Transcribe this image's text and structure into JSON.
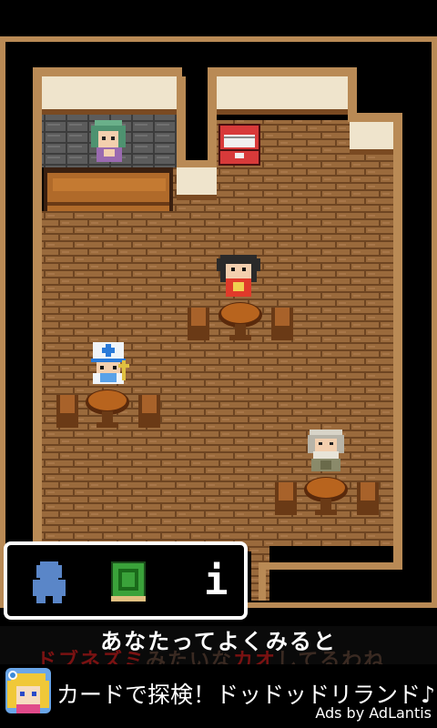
{
  "menu": {
    "items": [
      {
        "icon": "character-silhouette-icon"
      },
      {
        "icon": "green-book-icon"
      },
      {
        "label": "i"
      }
    ]
  },
  "dialog": {
    "line1": "あなたってよくみると",
    "line2_parts": [
      "ドブネズミ",
      "みたいな",
      "カオ",
      "してるわね"
    ]
  },
  "ad": {
    "text": "カードで探検！ドッドッドリランド♪",
    "credit": "Ads by AdLantis"
  }
}
